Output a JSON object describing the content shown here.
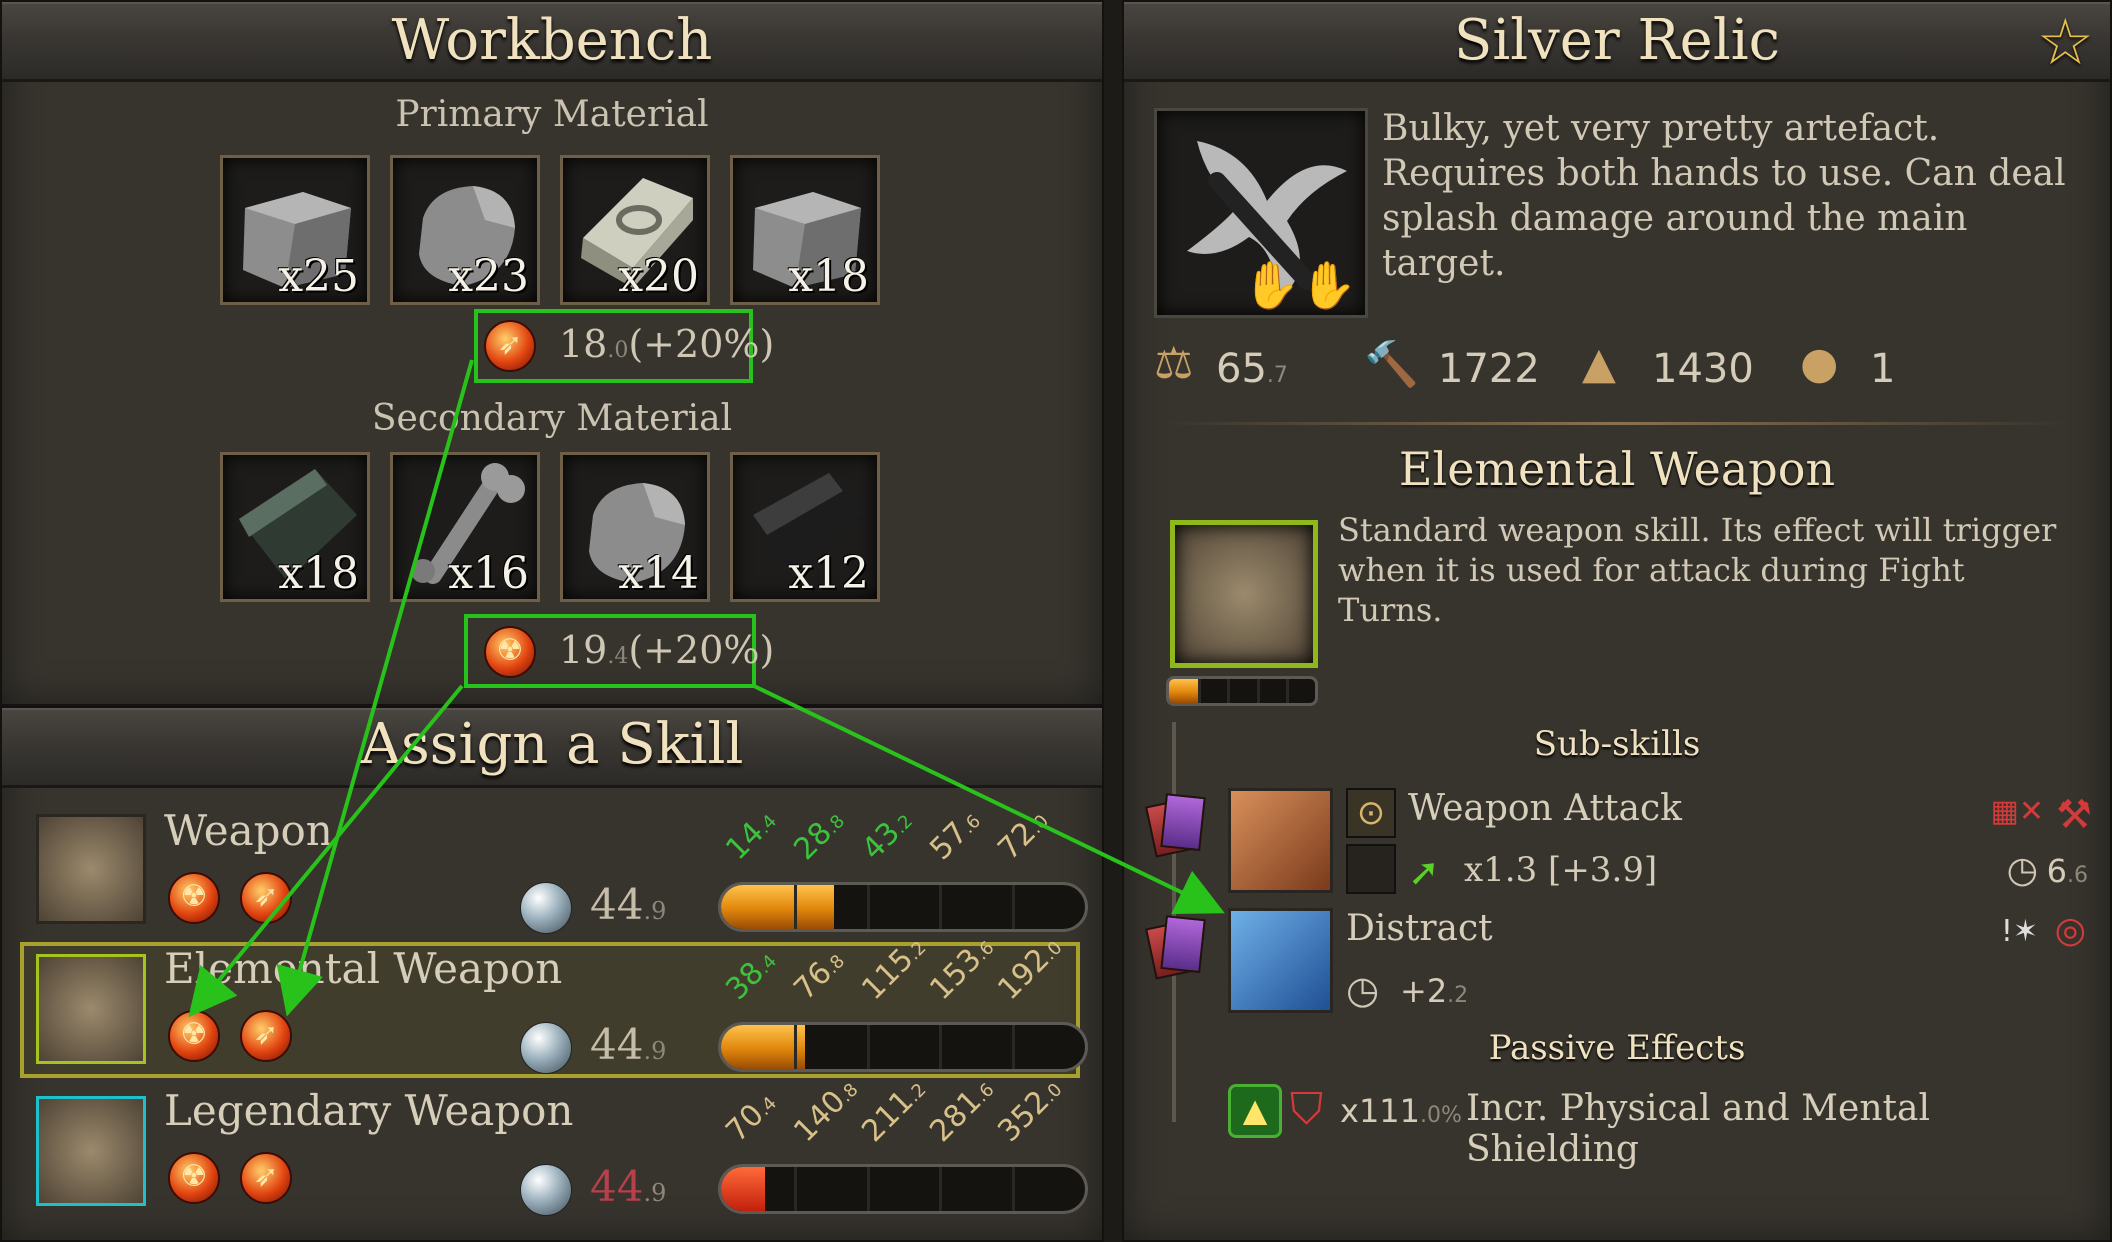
{
  "workbench": {
    "title": "Workbench",
    "primary_label": "Primary Material",
    "primary": [
      {
        "count": "x25",
        "icon": "stone-block-icon"
      },
      {
        "count": "x23",
        "icon": "rock-icon"
      },
      {
        "count": "x20",
        "icon": "silver-ingot-icon"
      },
      {
        "count": "x18",
        "icon": "stone-block-icon"
      }
    ],
    "primary_stat": {
      "main": "18",
      "frac": ".0",
      "pct": "(+20%)",
      "icon": "fire-arrow-element-icon"
    },
    "secondary_label": "Secondary Material",
    "secondary": [
      {
        "count": "x18",
        "icon": "dark-hide-icon"
      },
      {
        "count": "x16",
        "icon": "bone-icon"
      },
      {
        "count": "x14",
        "icon": "rock-icon"
      },
      {
        "count": "x12",
        "icon": "dark-leather-icon"
      }
    ],
    "secondary_stat": {
      "main": "19",
      "frac": ".4",
      "pct": "(+20%)",
      "icon": "fire-radiation-element-icon"
    }
  },
  "assign": {
    "title": "Assign a Skill",
    "rows": [
      {
        "name": "Weapon",
        "mana": "44",
        "mana_frac": ".9",
        "fill": 0.31,
        "ticks": [
          {
            "v": "14",
            "f": ".4",
            "c": "#3cc23c"
          },
          {
            "v": "28",
            "f": ".8",
            "c": "#3cc23c"
          },
          {
            "v": "43",
            "f": ".2",
            "c": "#3cc23c"
          },
          {
            "v": "57",
            "f": ".6",
            "c": "#d8c08a"
          },
          {
            "v": "72",
            "f": ".0",
            "c": "#d8c08a"
          }
        ]
      },
      {
        "name": "Elemental Weapon",
        "mana": "44",
        "mana_frac": ".9",
        "fill": 0.23,
        "ticks": [
          {
            "v": "38",
            "f": ".4",
            "c": "#3cc23c"
          },
          {
            "v": "76",
            "f": ".8",
            "c": "#d8c08a"
          },
          {
            "v": "115",
            "f": ".2",
            "c": "#d8c08a"
          },
          {
            "v": "153",
            "f": ".6",
            "c": "#d8c08a"
          },
          {
            "v": "192",
            "f": ".0",
            "c": "#d8c08a"
          }
        ]
      },
      {
        "name": "Legendary Weapon",
        "mana": "44",
        "mana_frac": ".9",
        "fill": 0.12,
        "ticks": [
          {
            "v": "70",
            "f": ".4",
            "c": "#d8c08a"
          },
          {
            "v": "140",
            "f": ".8",
            "c": "#d8c08a"
          },
          {
            "v": "211",
            "f": ".2",
            "c": "#d8c08a"
          },
          {
            "v": "281",
            "f": ".6",
            "c": "#d8c08a"
          },
          {
            "v": "352",
            "f": ".0",
            "c": "#d8c08a"
          }
        ]
      }
    ]
  },
  "relic": {
    "title": "Silver Relic",
    "description": "Bulky, yet very pretty artefact. Requires both hands to use. Can deal splash damage around the main target.",
    "weight": "65",
    "weight_frac": ".7",
    "attack": "1722",
    "value": "1430",
    "quantity": "1",
    "skill_title": "Elemental Weapon",
    "skill_desc": "Standard weapon skill. Its effect will trigger when it is used for attack during Fight Turns.",
    "skill_level": 0.2,
    "subskills_label": "Sub-skills",
    "sub1": {
      "name": "Weapon Attack",
      "mult": "x1.3 [+3.9]",
      "cooldown": "6",
      "cooldown_frac": ".6"
    },
    "sub2": {
      "name": "Distract",
      "value": "+2",
      "value_frac": ".2"
    },
    "passive_label": "Passive Effects",
    "passive": {
      "pct": "x111",
      "pct_frac": ".0%",
      "text": "Incr. Physical and Mental Shielding"
    }
  }
}
